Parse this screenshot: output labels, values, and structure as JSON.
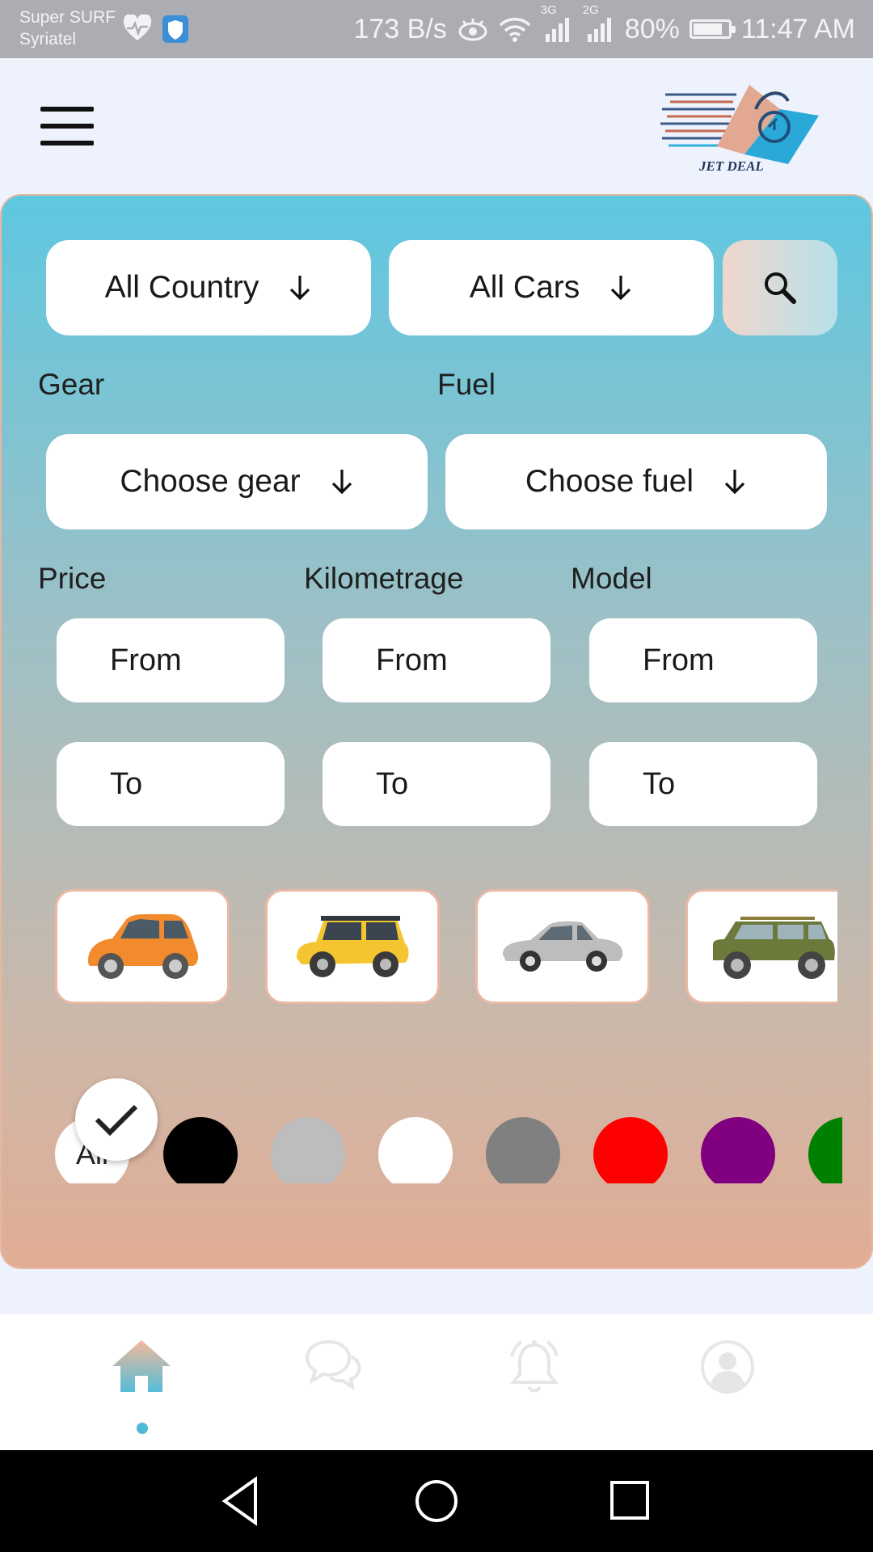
{
  "status_bar": {
    "carrier_line1": "Super SURF",
    "carrier_line2": "Syriatel",
    "net_speed": "173 B/s",
    "signal_3g": "3G",
    "signal_2g": "2G",
    "battery": "80%",
    "battery_level": 0.8,
    "time": "11:47 AM"
  },
  "header": {
    "logo_text": "JET DEAL"
  },
  "filters": {
    "country": "All Country",
    "cars": "All Cars",
    "gear_label": "Gear",
    "gear_value": "Choose gear",
    "fuel_label": "Fuel",
    "fuel_value": "Choose fuel",
    "price_label": "Price",
    "km_label": "Kilometrage",
    "model_label": "Model",
    "price_from": "From",
    "price_to": "To",
    "km_from": "From",
    "km_to": "To",
    "model_from": "From",
    "model_to": "To"
  },
  "car_types": [
    {
      "name": "city-car",
      "color": "#f28a2e"
    },
    {
      "name": "hatchback",
      "color": "#f4c531"
    },
    {
      "name": "sedan",
      "color": "#bdbdbd"
    },
    {
      "name": "suv",
      "color": "#6b7a3a"
    }
  ],
  "colors": {
    "all_label": "All",
    "selected": "All",
    "swatches": [
      "#000000",
      "#bdbdbd",
      "#ffffff",
      "#808080",
      "#ff0000",
      "#800080",
      "#008000"
    ]
  },
  "theme": {
    "accent": "#4fb9d8",
    "panel_top": "#5ec7e0",
    "panel_bottom": "#e2ad95"
  },
  "nav": {
    "items": [
      "home",
      "chat",
      "notifications",
      "profile"
    ],
    "active": "home"
  }
}
